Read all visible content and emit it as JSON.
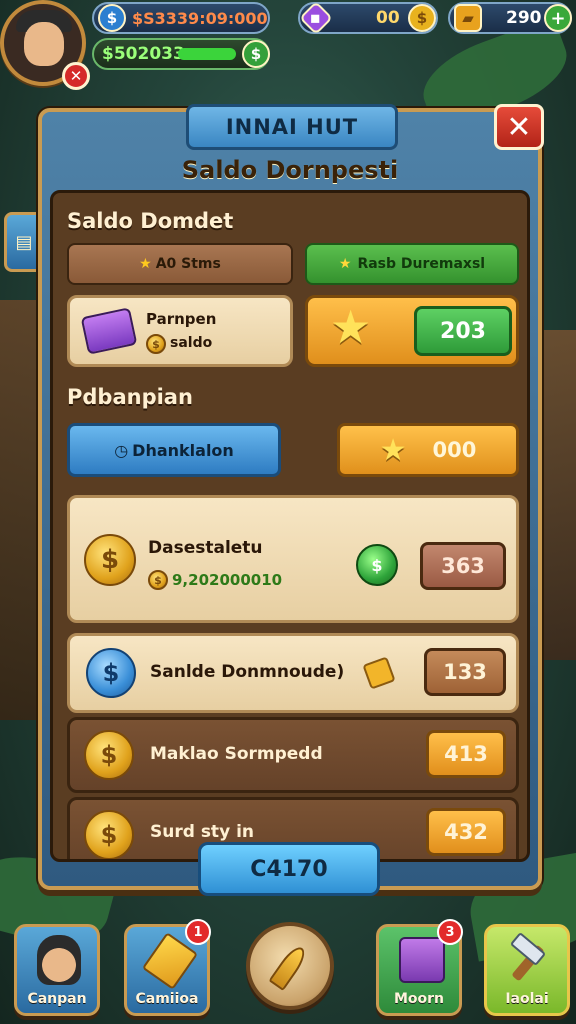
{
  "hud": {
    "coins_top": "$S3339:09:000",
    "cash": "$502033",
    "gems": "00",
    "tickets": "290"
  },
  "panel": {
    "banner_title": "INNAI HUT",
    "subtitle": "Saldo Dornpesti",
    "close_label": "✕"
  },
  "section1": {
    "title": "Saldo Domdet",
    "tab_left_label": "A0 Stms",
    "tab_right_label": "Rasb Duremaxsl",
    "item_name": "Parnpen",
    "item_value": "saldo",
    "reward_value": "203"
  },
  "section2": {
    "title": "Pdbanpian",
    "button_label": "Dhanklalon",
    "stars_value": "000"
  },
  "rows": [
    {
      "label": "Dasestaletu",
      "sub": "9,202000010",
      "value": "363",
      "coin": "$"
    },
    {
      "label": "Sanlde Donmnoude)",
      "value": "133",
      "coin": "$"
    },
    {
      "label": "Maklao Sormpedd",
      "value": "413",
      "coin": "$"
    },
    {
      "label": "Surd sty in",
      "value": "432",
      "coin": "$"
    }
  ],
  "total": "C4170",
  "nav": [
    {
      "label": "Canpan",
      "badge": ""
    },
    {
      "label": "Camiioa",
      "badge": "1"
    },
    {
      "label": "Moorn",
      "badge": "3"
    },
    {
      "label": "Iaolai",
      "badge": ""
    }
  ],
  "colors": {
    "panel_blue": "#3f6f96",
    "gold": "#e0a21c",
    "green": "#34922e",
    "orange": "#e0901c"
  }
}
